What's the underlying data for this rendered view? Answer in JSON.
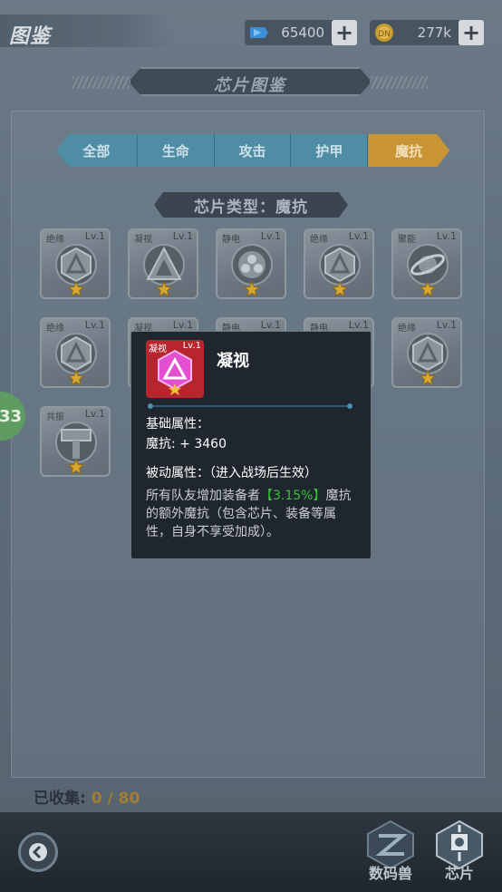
{
  "topbar": {
    "title": "图鉴",
    "currencies": [
      {
        "icon": "diamond-icon",
        "value": "65400"
      },
      {
        "icon": "coin-icon",
        "value": "277k"
      }
    ],
    "plus": "+"
  },
  "banner": {
    "title": "芯片图鉴"
  },
  "tabs": [
    {
      "label": "全部",
      "active": false
    },
    {
      "label": "生命",
      "active": false
    },
    {
      "label": "攻击",
      "active": false
    },
    {
      "label": "护甲",
      "active": false
    },
    {
      "label": "魔抗",
      "active": true
    }
  ],
  "chip_type_title": "芯片类型：魔抗",
  "chips": [
    {
      "tag": "绝缘",
      "level": "Lv.1",
      "emblem": "hex-triangle"
    },
    {
      "tag": "凝视",
      "level": "Lv.1",
      "emblem": "triangle"
    },
    {
      "tag": "静电",
      "level": "Lv.1",
      "emblem": "circles"
    },
    {
      "tag": "绝缘",
      "level": "Lv.1",
      "emblem": "hex-triangle"
    },
    {
      "tag": "聚能",
      "level": "Lv.1",
      "emblem": "orbit"
    },
    {
      "tag": "绝缘",
      "level": "Lv.1",
      "emblem": "hex-triangle"
    },
    {
      "tag": "凝视",
      "level": "Lv.1",
      "emblem": "triangle"
    },
    {
      "tag": "静电",
      "level": "Lv.1",
      "emblem": "circles"
    },
    {
      "tag": "静电",
      "level": "Lv.1",
      "emblem": "circles"
    },
    {
      "tag": "绝缘",
      "level": "Lv.1",
      "emblem": "hex-triangle"
    },
    {
      "tag": "共振",
      "level": "Lv.1",
      "emblem": "hammer"
    }
  ],
  "side_avatar_level": "33",
  "tooltip": {
    "icon_tag": "凝视",
    "icon_level": "Lv.1",
    "name": "凝视",
    "base_attr_title": "基础属性：",
    "base_attr_value": "魔抗: + 3460",
    "passive_title": "被动属性：（进入战场后生效）",
    "desc_before": "所有队友增加装备者",
    "desc_highlight": "【3.15%】",
    "desc_after": "魔抗的额外魔抗（包含芯片、装备等属性，自身不享受加成）。"
  },
  "collected": {
    "label": "已收集:",
    "count": "0 / 80"
  },
  "bottom_nav": [
    {
      "label": "数码兽",
      "icon": "digimon-icon"
    },
    {
      "label": "芯片",
      "icon": "chip-icon"
    }
  ],
  "colors": {
    "tab_normal": "#4f8da5",
    "tab_active": "#c89434",
    "highlight_green": "#3bbf3b",
    "tooltip_icon_bg": "#b7252f"
  }
}
